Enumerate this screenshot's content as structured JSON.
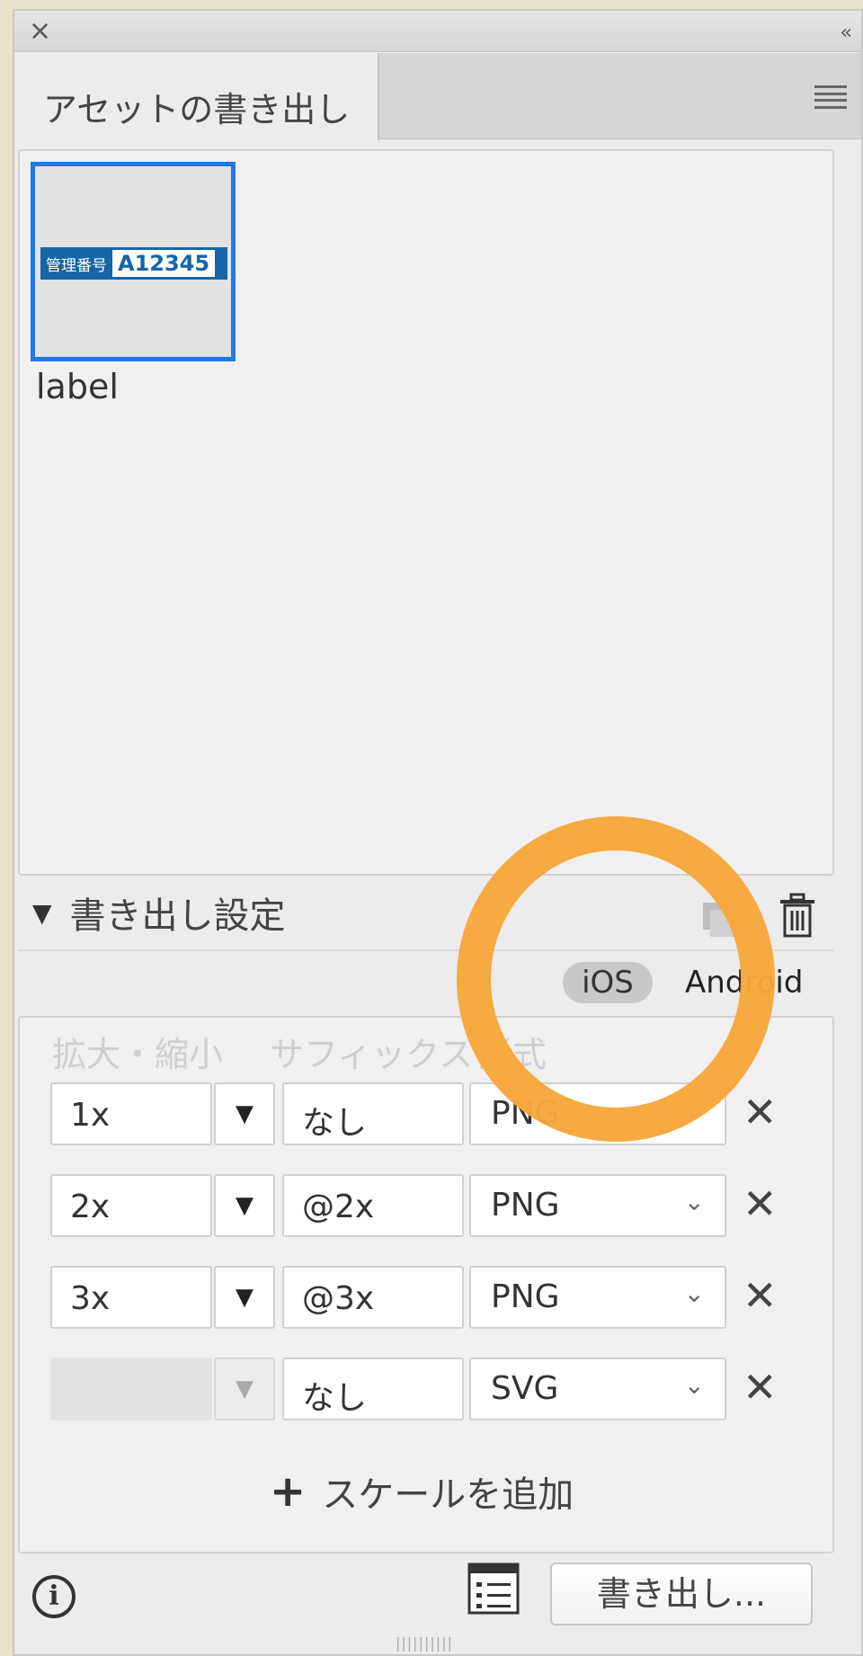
{
  "window": {
    "title": "アセットの書き出し",
    "close_glyph": "×",
    "collapse_glyph": "‹‹"
  },
  "assets": [
    {
      "name": "label",
      "thumb_label": "管理番号",
      "thumb_code": "A12345",
      "selected": true
    }
  ],
  "settings": {
    "header": "書き出し設定",
    "platforms": {
      "ios": "iOS",
      "android": "Android",
      "active": "iOS"
    },
    "column_headers": {
      "scale": "拡大・縮小",
      "suffix": "サフィックス",
      "format": "形式"
    },
    "rows": [
      {
        "scale": "1x",
        "suffix": "なし",
        "format": "PNG",
        "disabled": false
      },
      {
        "scale": "2x",
        "suffix": "@2x",
        "format": "PNG",
        "disabled": false
      },
      {
        "scale": "3x",
        "suffix": "@3x",
        "format": "PNG",
        "disabled": false
      },
      {
        "scale": "",
        "suffix": "なし",
        "format": "SVG",
        "disabled": true
      }
    ],
    "add_scale_label": "スケールを追加"
  },
  "footer": {
    "export_button": "書き出し..."
  },
  "colors": {
    "selection": "#1f78e6",
    "highlight": "#f7a73a",
    "thumb_badge": "#1565a8"
  }
}
